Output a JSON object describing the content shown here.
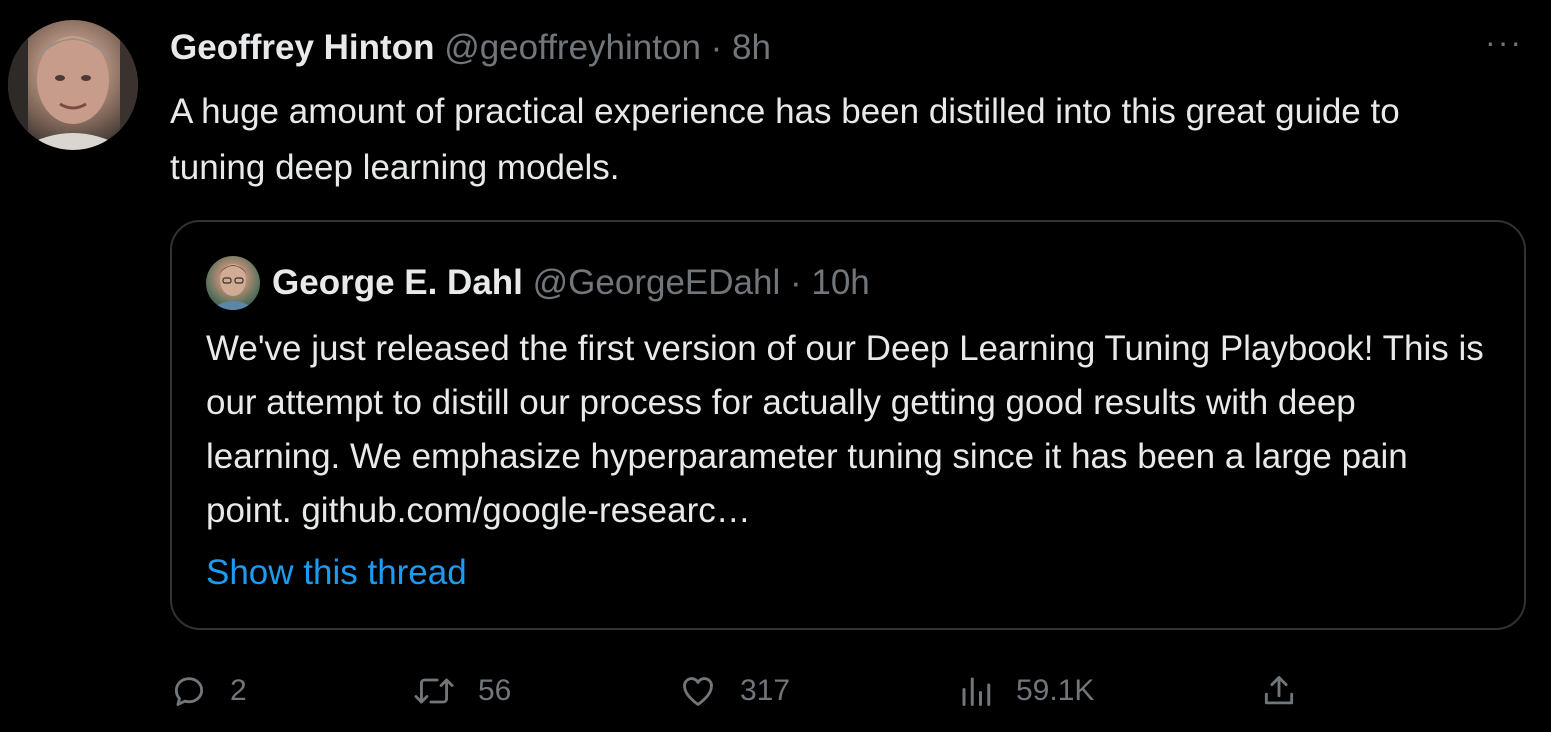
{
  "tweet": {
    "author_name": "Geoffrey Hinton",
    "author_handle": "@geoffreyhinton",
    "separator": "·",
    "time": "8h",
    "more_label": "···",
    "text": "A huge amount of practical experience has been distilled into this great guide to tuning deep learning models."
  },
  "quote": {
    "author_name": "George E. Dahl",
    "author_handle": "@GeorgeEDahl",
    "separator": "·",
    "time": "10h",
    "text": "We've just released the first version of our Deep Learning Tuning Playbook! This is our attempt to distill our process for actually getting good results with deep learning. We emphasize hyperparameter tuning since it has been a large pain point. github.com/google-researc…",
    "show_thread": "Show this thread"
  },
  "actions": {
    "replies": "2",
    "retweets": "56",
    "likes": "317",
    "views": "59.1K"
  },
  "icons": {
    "reply": "reply-icon",
    "retweet": "retweet-icon",
    "like": "heart-icon",
    "views": "views-icon",
    "share": "share-icon",
    "more": "more-icon"
  },
  "colors": {
    "background": "#000000",
    "text": "#e7e9ea",
    "secondary": "#71767b",
    "link": "#1d9bf0",
    "border": "#2f3336"
  }
}
